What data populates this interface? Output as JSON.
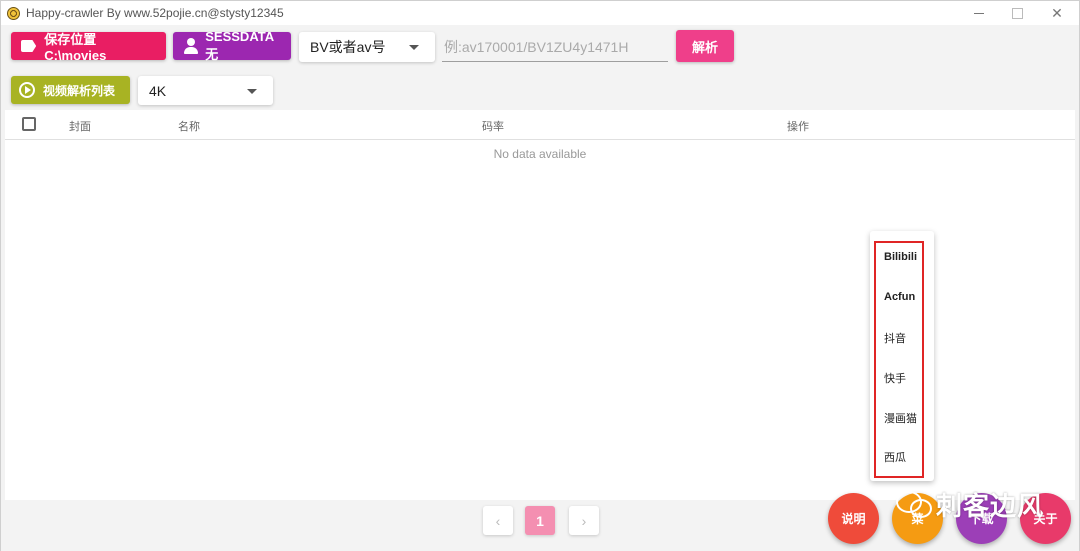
{
  "window": {
    "title": "Happy-crawler By www.52pojie.cn@stysty12345",
    "minimize": "",
    "maximize": "",
    "close": "✕"
  },
  "toolbar": {
    "save_location_label": "保存位置 C:\\movies",
    "sessdata_label": "SESSDATA 无",
    "id_type_selected": "BV或者av号",
    "id_input_placeholder": "例:av170001/BV1ZU4y1471H",
    "parse_label": "解析",
    "video_list_label": "视频解析列表",
    "quality_selected": "4K"
  },
  "table": {
    "headers": [
      "封面",
      "名称",
      "码率",
      "操作"
    ],
    "empty_text": "No data available"
  },
  "pagination": {
    "prev": "‹",
    "current": "1",
    "next": "›"
  },
  "platform_menu": {
    "items": [
      "Bilibili",
      "Acfun",
      "抖音",
      "快手",
      "漫画猫",
      "西瓜"
    ]
  },
  "fabs": {
    "help_label": "说明",
    "b_label": "菜",
    "c_label": "下载",
    "d_label": "关于"
  },
  "watermark": {
    "text": "刺客边风"
  },
  "colors": {
    "save_button": "#e91e63",
    "sessdata_button": "#9c27b0",
    "parse_button": "#ef3f8a",
    "video_list_button": "#a8b323",
    "pager_active": "#f48fb1",
    "menu_highlight": "#e02525"
  },
  "icons": {
    "save_location": "tag-icon",
    "sessdata": "person-icon",
    "video_list": "play-circle-icon",
    "dropdown": "chevron-down-icon"
  }
}
